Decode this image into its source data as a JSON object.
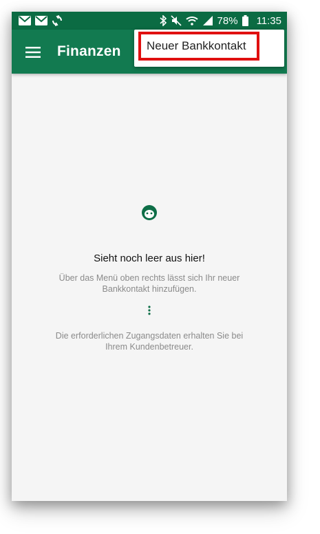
{
  "status_bar": {
    "battery": "78%",
    "time": "11:35",
    "icons_left": [
      "mail-icon",
      "mail-icon",
      "sync-icon"
    ],
    "icons_right": [
      "bluetooth-icon",
      "mute-icon",
      "wifi-icon",
      "signal-icon",
      "battery-icon"
    ]
  },
  "app_bar": {
    "title": "Finanzen",
    "menu_icon": "menu-icon"
  },
  "popup_menu": {
    "items": [
      {
        "label": "Neuer Bankkontakt"
      }
    ]
  },
  "empty_state": {
    "icon": "face-icon",
    "title": "Sieht noch leer aus hier!",
    "text": "Über das Menü oben rechts lässt sich Ihr neuer Bankkontakt hinzufügen.",
    "overflow_icon": "more-vert-icon",
    "text2": "Die erforderlichen Zugangsdaten erhalten Sie bei Ihrem Kundenbetreuer."
  },
  "colors": {
    "status_bar": "#0b6b43",
    "app_bar": "#127a50",
    "accent": "#0e6e47",
    "highlight": "#e01010"
  }
}
